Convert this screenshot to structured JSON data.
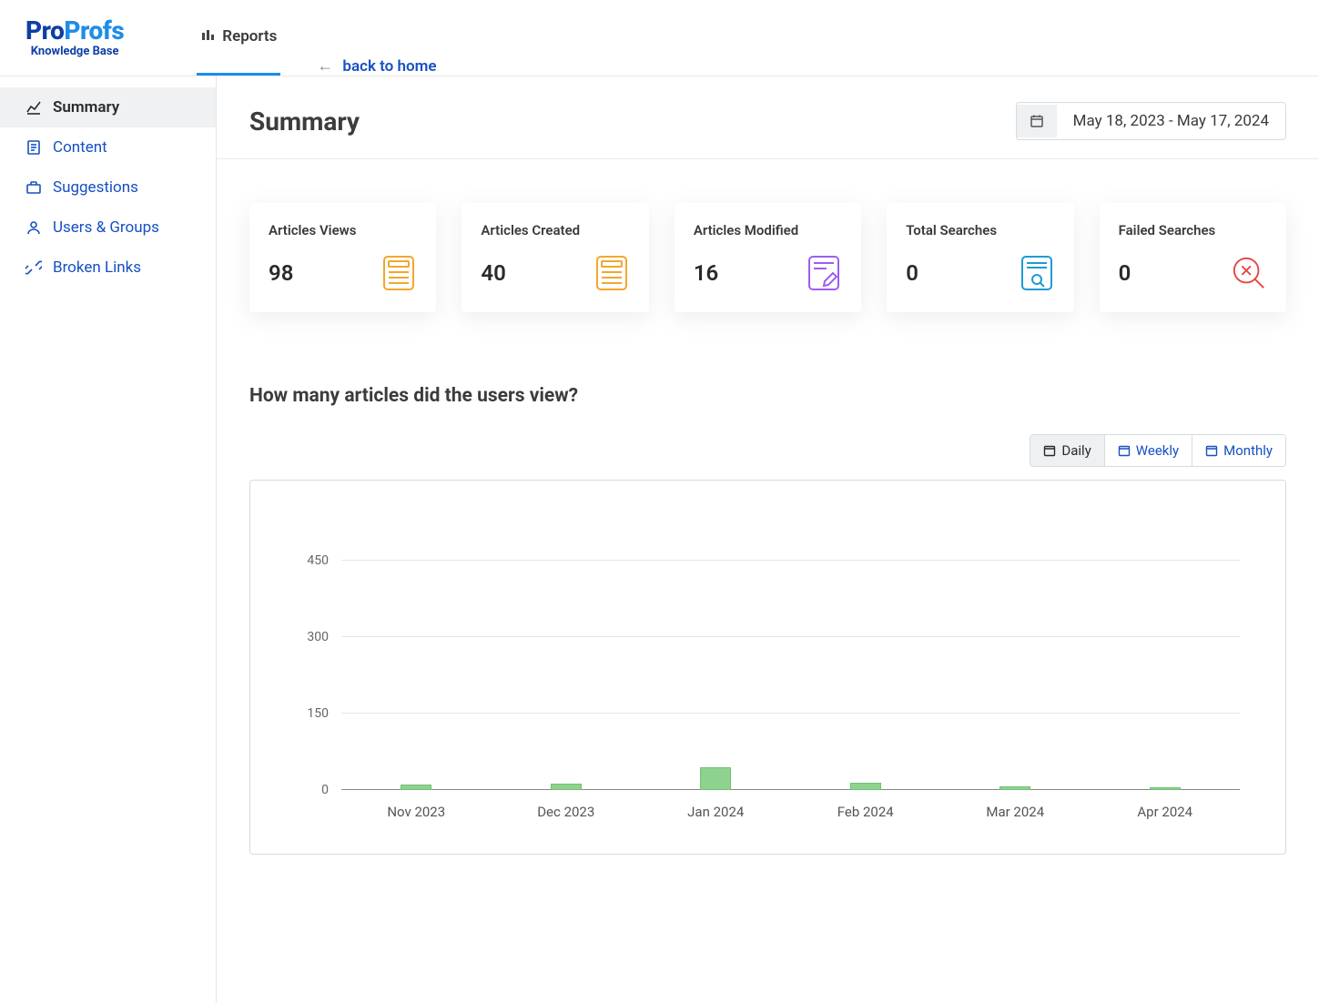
{
  "brand": {
    "name1": "Pro",
    "name2": "Profs",
    "sub": "Knowledge Base"
  },
  "header": {
    "tabs": [
      {
        "label": "Reports",
        "active": true
      }
    ],
    "back_label": "back to home"
  },
  "sidebar": {
    "items": [
      {
        "label": "Summary",
        "active": true
      },
      {
        "label": "Content"
      },
      {
        "label": "Suggestions"
      },
      {
        "label": "Users & Groups"
      },
      {
        "label": "Broken Links"
      }
    ]
  },
  "page": {
    "title": "Summary",
    "date_range": "May 18, 2023 - May 17, 2024"
  },
  "stats": [
    {
      "label": "Articles Views",
      "value": "98",
      "icon": "doc",
      "color": "#f2a72e"
    },
    {
      "label": "Articles Created",
      "value": "40",
      "icon": "doc",
      "color": "#f2a72e"
    },
    {
      "label": "Articles Modified",
      "value": "16",
      "icon": "edit",
      "color": "#9b5ef0"
    },
    {
      "label": "Total Searches",
      "value": "0",
      "icon": "search",
      "color": "#1f9ad6"
    },
    {
      "label": "Failed Searches",
      "value": "0",
      "icon": "fail",
      "color": "#e64545"
    }
  ],
  "chart_section": {
    "title": "How many articles did the users view?",
    "toggle": [
      {
        "label": "Daily",
        "active": true
      },
      {
        "label": "Weekly"
      },
      {
        "label": "Monthly"
      }
    ]
  },
  "chart_data": {
    "type": "bar",
    "categories": [
      "Nov 2023",
      "Dec 2023",
      "Jan 2024",
      "Feb 2024",
      "Mar 2024",
      "Apr 2024"
    ],
    "values": [
      10,
      12,
      45,
      14,
      8,
      6
    ],
    "title": "How many articles did the users view?",
    "xlabel": "",
    "ylabel": "",
    "ylim": [
      0,
      500
    ],
    "yticks": [
      0,
      150,
      300,
      450
    ]
  }
}
